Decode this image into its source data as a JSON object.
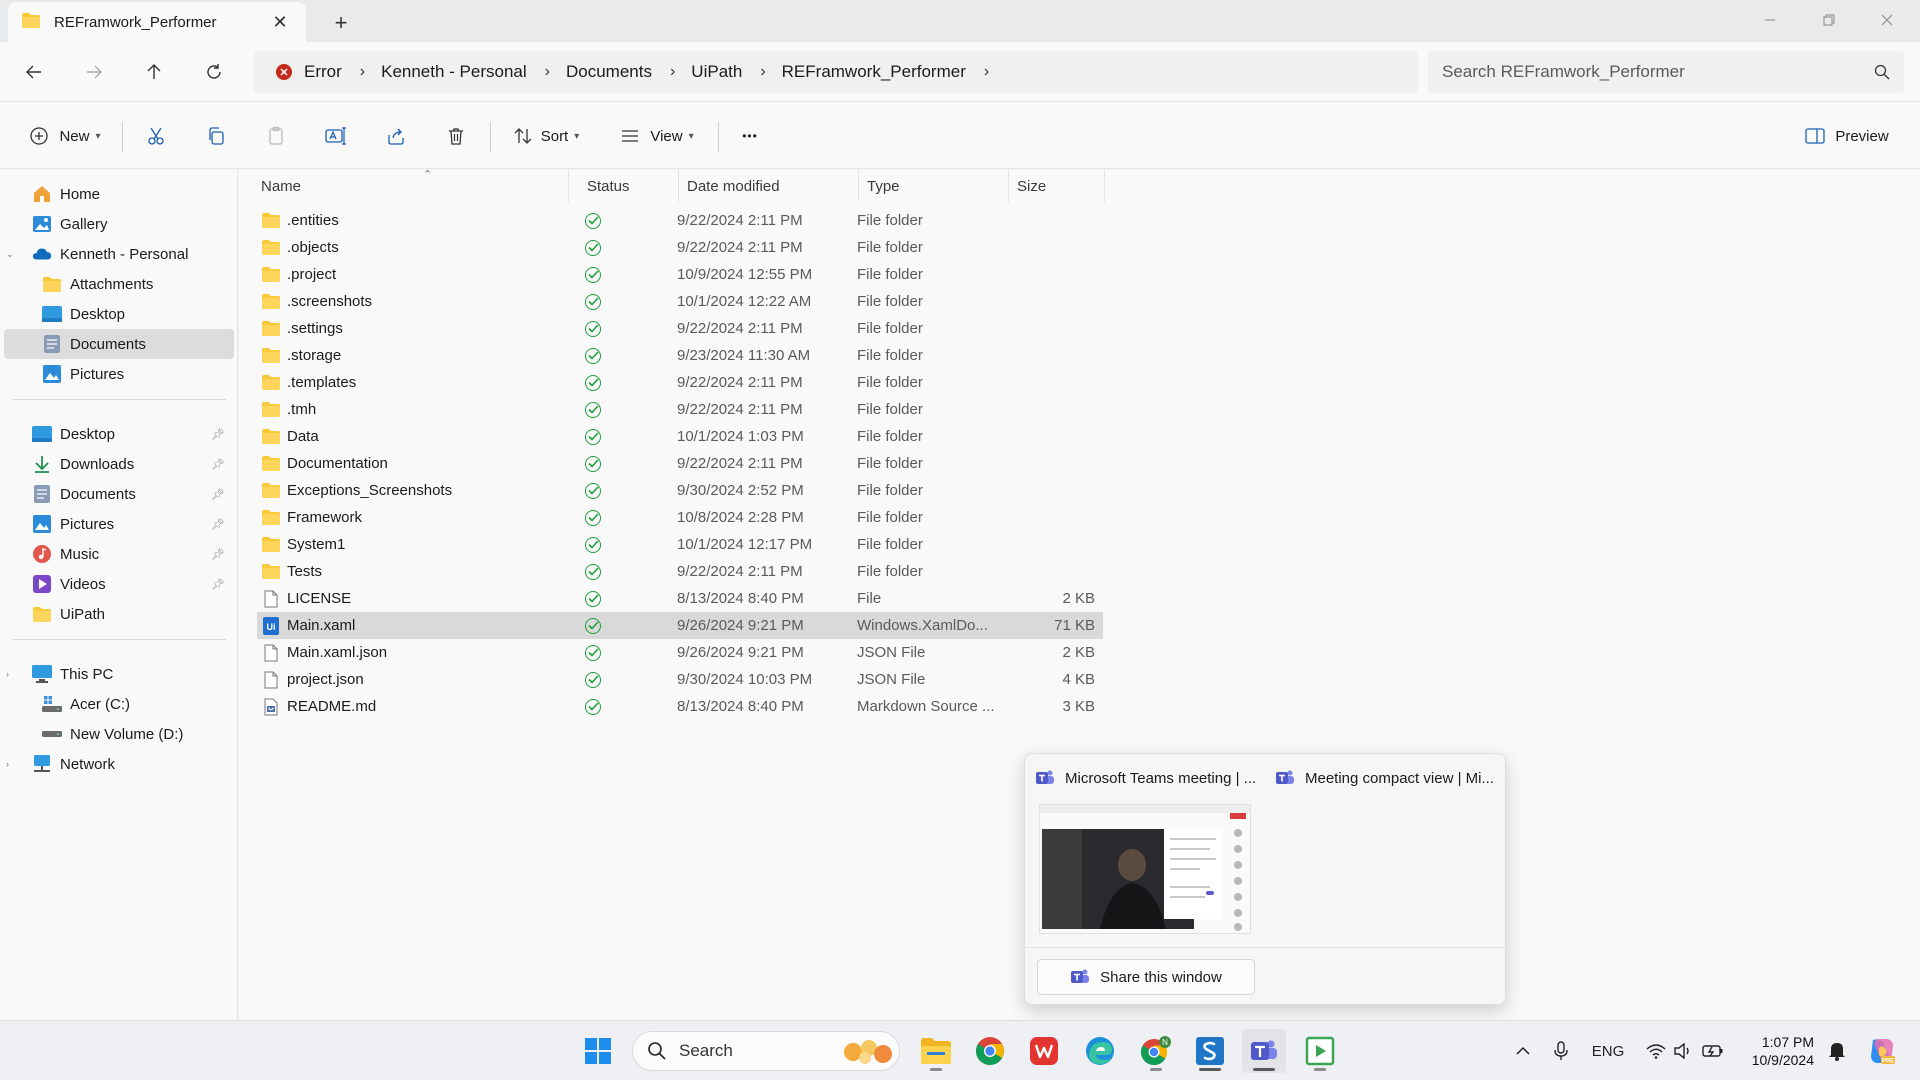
{
  "window": {
    "tab_title": "REFramwork_Performer",
    "new_tab_symbol": "+",
    "close_tab_symbol": "✕"
  },
  "address": {
    "breadcrumbs": [
      "Error",
      "Kenneth - Personal",
      "Documents",
      "UiPath",
      "REFramwork_Performer"
    ],
    "search_placeholder": "Search REFramwork_Performer"
  },
  "toolbar": {
    "new_label": "New",
    "sort_label": "Sort",
    "view_label": "View",
    "preview_label": "Preview",
    "more_symbol": "•••"
  },
  "sidebar": {
    "quick": [
      {
        "label": "Home",
        "icon": "home-icon"
      },
      {
        "label": "Gallery",
        "icon": "gallery-icon"
      },
      {
        "label": "Kenneth - Personal",
        "icon": "onedrive-icon"
      },
      {
        "label": "Attachments",
        "icon": "folder-icon"
      },
      {
        "label": "Desktop",
        "icon": "desktop-icon"
      },
      {
        "label": "Documents",
        "icon": "documents-icon"
      },
      {
        "label": "Pictures",
        "icon": "pictures-icon"
      }
    ],
    "pinned": [
      {
        "label": "Desktop",
        "icon": "desktop-icon"
      },
      {
        "label": "Downloads",
        "icon": "downloads-icon"
      },
      {
        "label": "Documents",
        "icon": "documents-icon"
      },
      {
        "label": "Pictures",
        "icon": "pictures-icon"
      },
      {
        "label": "Music",
        "icon": "music-icon"
      },
      {
        "label": "Videos",
        "icon": "videos-icon"
      },
      {
        "label": "UiPath",
        "icon": "folder-icon"
      }
    ],
    "devices": [
      {
        "label": "This PC",
        "icon": "pc-icon"
      },
      {
        "label": "Acer (C:)",
        "icon": "drive-c-icon"
      },
      {
        "label": "New Volume (D:)",
        "icon": "drive-icon"
      },
      {
        "label": "Network",
        "icon": "network-icon"
      }
    ]
  },
  "columns": [
    "Name",
    "Status",
    "Date modified",
    "Type",
    "Size"
  ],
  "files": [
    {
      "name": ".entities",
      "date": "9/22/2024 2:11 PM",
      "type": "File folder",
      "size": "",
      "kind": "folder"
    },
    {
      "name": ".objects",
      "date": "9/22/2024 2:11 PM",
      "type": "File folder",
      "size": "",
      "kind": "folder"
    },
    {
      "name": ".project",
      "date": "10/9/2024 12:55 PM",
      "type": "File folder",
      "size": "",
      "kind": "folder"
    },
    {
      "name": ".screenshots",
      "date": "10/1/2024 12:22 AM",
      "type": "File folder",
      "size": "",
      "kind": "folder"
    },
    {
      "name": ".settings",
      "date": "9/22/2024 2:11 PM",
      "type": "File folder",
      "size": "",
      "kind": "folder"
    },
    {
      "name": ".storage",
      "date": "9/23/2024 11:30 AM",
      "type": "File folder",
      "size": "",
      "kind": "folder"
    },
    {
      "name": ".templates",
      "date": "9/22/2024 2:11 PM",
      "type": "File folder",
      "size": "",
      "kind": "folder"
    },
    {
      "name": ".tmh",
      "date": "9/22/2024 2:11 PM",
      "type": "File folder",
      "size": "",
      "kind": "folder"
    },
    {
      "name": "Data",
      "date": "10/1/2024 1:03 PM",
      "type": "File folder",
      "size": "",
      "kind": "folder"
    },
    {
      "name": "Documentation",
      "date": "9/22/2024 2:11 PM",
      "type": "File folder",
      "size": "",
      "kind": "folder"
    },
    {
      "name": "Exceptions_Screenshots",
      "date": "9/30/2024 2:52 PM",
      "type": "File folder",
      "size": "",
      "kind": "folder"
    },
    {
      "name": "Framework",
      "date": "10/8/2024 2:28 PM",
      "type": "File folder",
      "size": "",
      "kind": "folder"
    },
    {
      "name": "System1",
      "date": "10/1/2024 12:17 PM",
      "type": "File folder",
      "size": "",
      "kind": "folder"
    },
    {
      "name": "Tests",
      "date": "9/22/2024 2:11 PM",
      "type": "File folder",
      "size": "",
      "kind": "folder"
    },
    {
      "name": "LICENSE",
      "date": "8/13/2024 8:40 PM",
      "type": "File",
      "size": "2 KB",
      "kind": "file"
    },
    {
      "name": "Main.xaml",
      "date": "9/26/2024 9:21 PM",
      "type": "Windows.XamlDo...",
      "size": "71 KB",
      "kind": "xaml"
    },
    {
      "name": "Main.xaml.json",
      "date": "9/26/2024 9:21 PM",
      "type": "JSON File",
      "size": "2 KB",
      "kind": "file"
    },
    {
      "name": "project.json",
      "date": "9/30/2024 10:03 PM",
      "type": "JSON File",
      "size": "4 KB",
      "kind": "file"
    },
    {
      "name": "README.md",
      "date": "8/13/2024 8:40 PM",
      "type": "Markdown Source ...",
      "size": "3 KB",
      "kind": "md"
    }
  ],
  "preview_popup": {
    "window1_title": "Microsoft Teams meeting | ...",
    "window2_title": "Meeting compact view | Mi...",
    "share_label": "Share this window"
  },
  "taskbar": {
    "search_label": "Search",
    "language": "ENG",
    "time": "1:07 PM",
    "date": "10/9/2024"
  },
  "colors": {
    "accent": "#0067c0",
    "folder": "#f8c93a",
    "status_ok": "#1f9e3a",
    "selected_row": "#d9d9d9",
    "error": "#c42b1c"
  }
}
